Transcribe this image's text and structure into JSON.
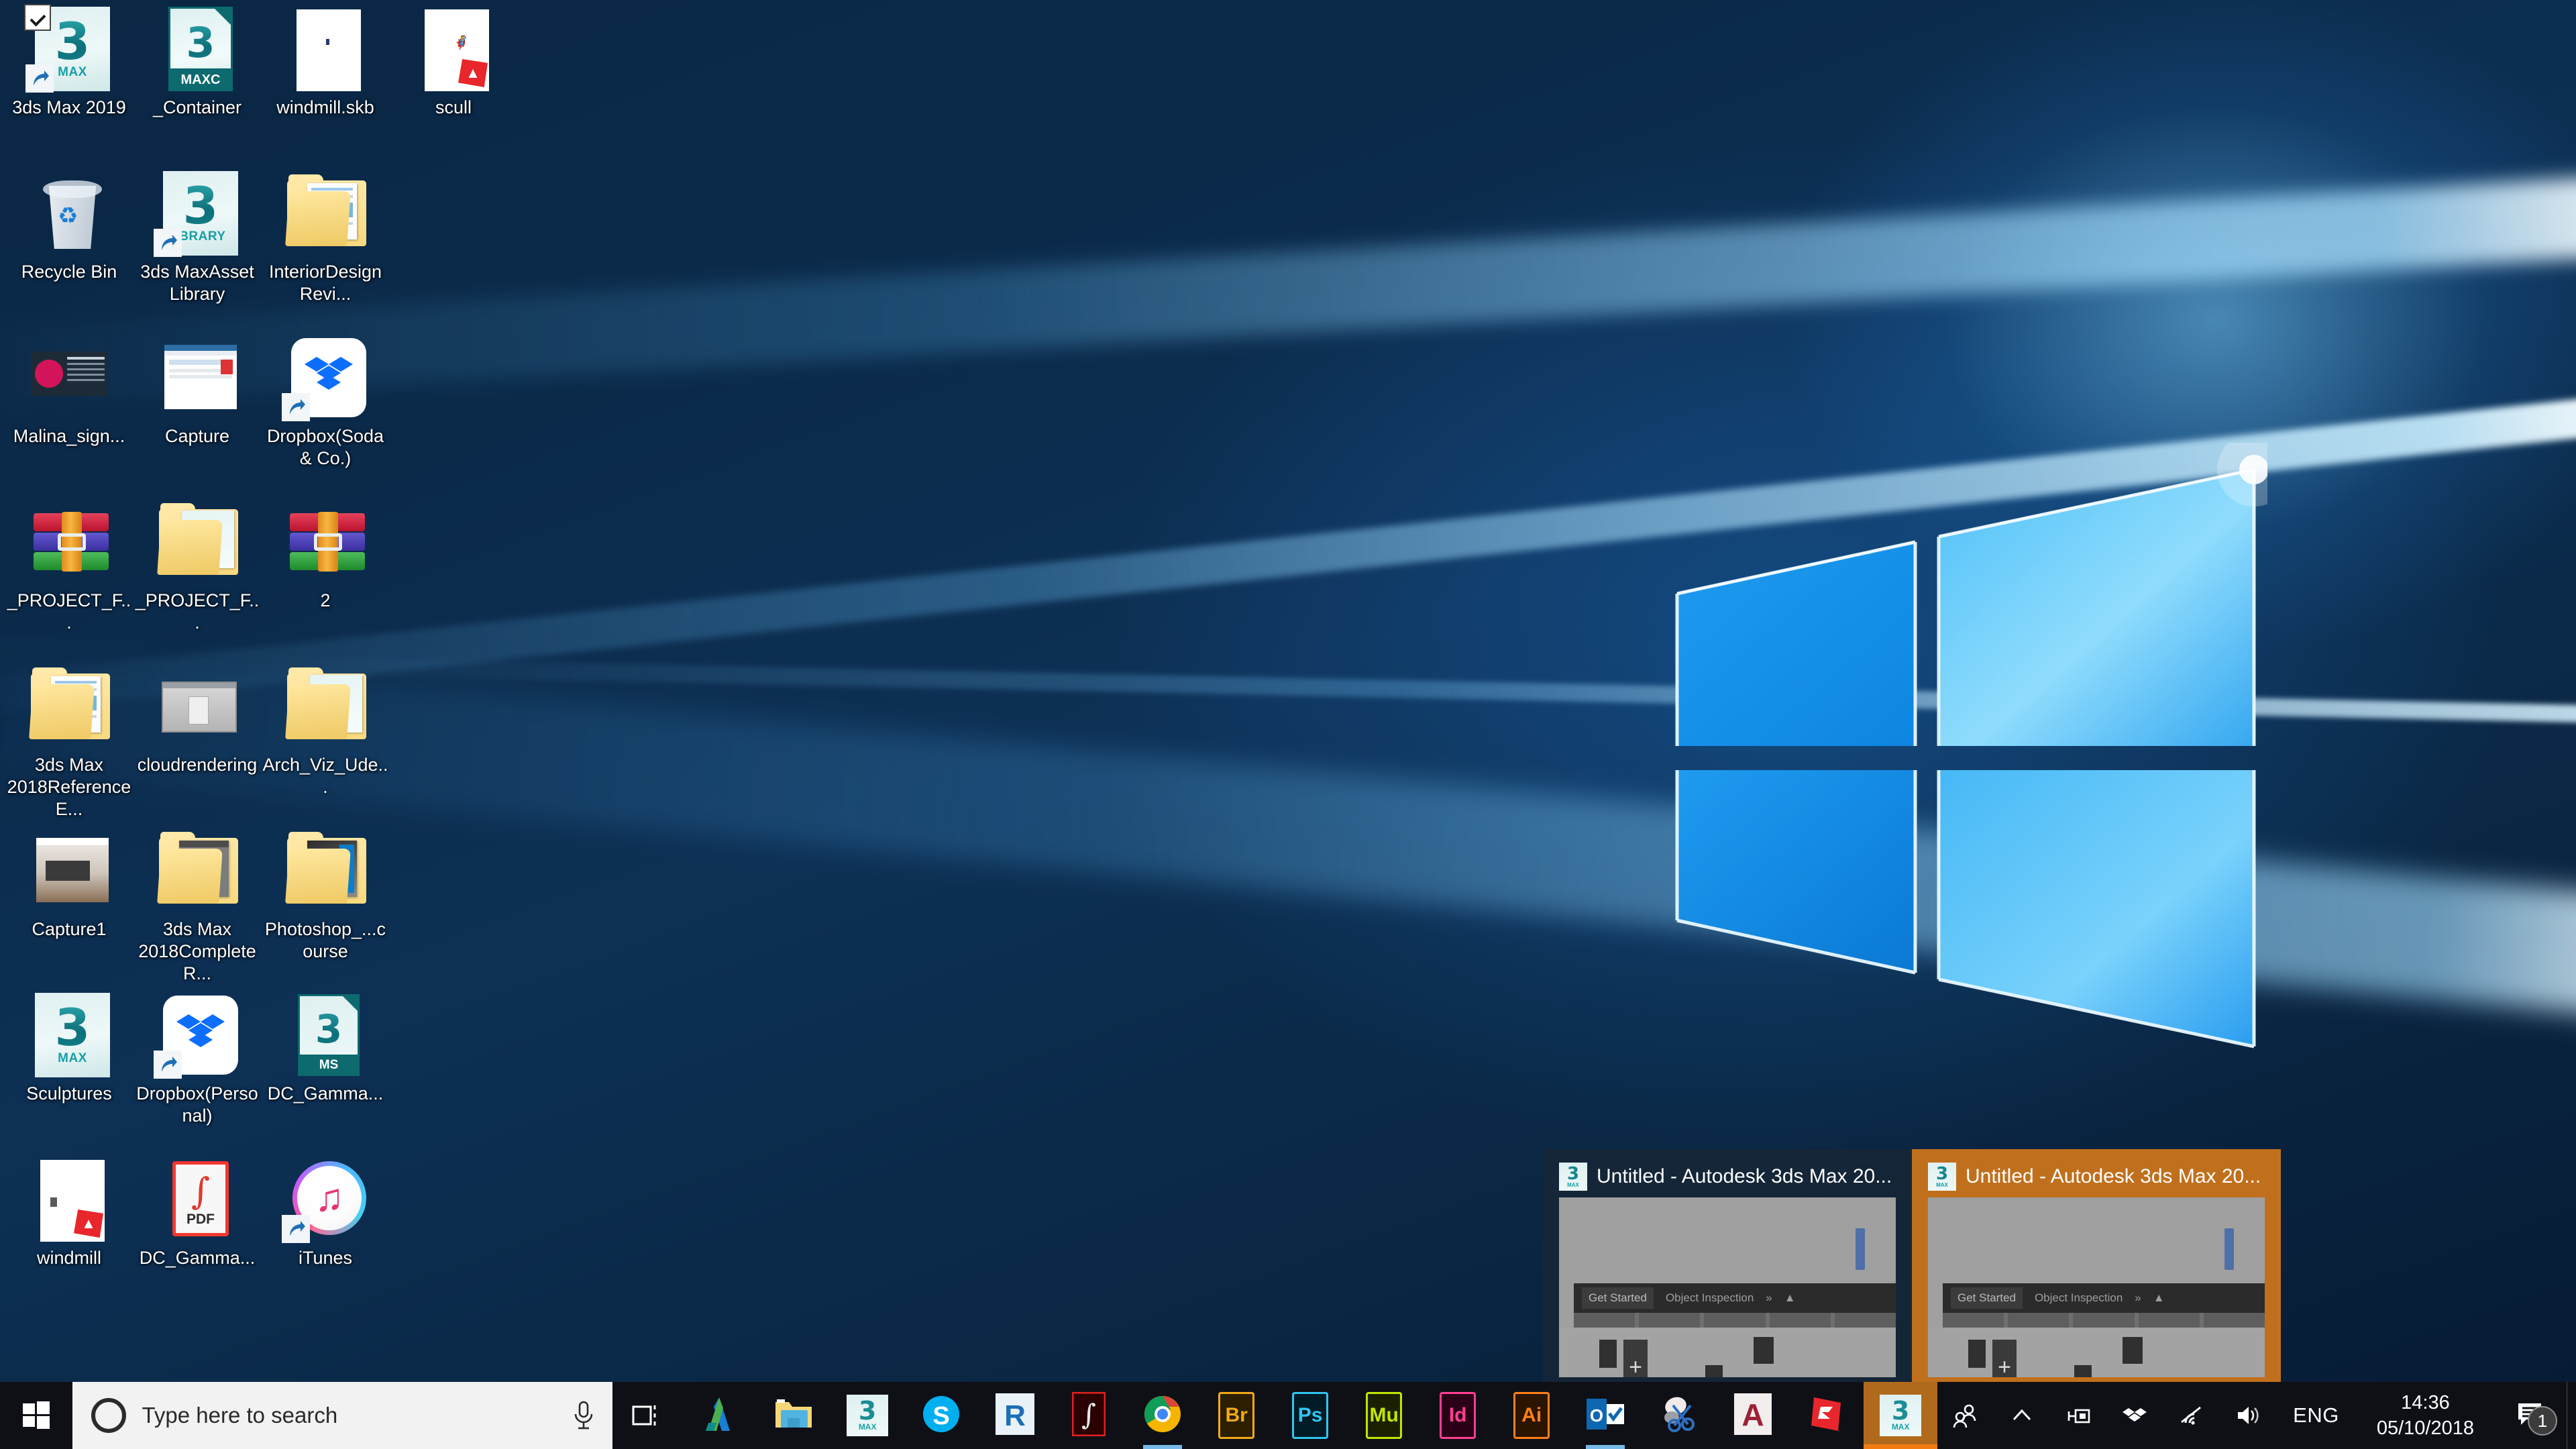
{
  "desktop": {
    "icons": [
      {
        "label": "3ds Max 2019",
        "art": "max-shortcut",
        "selected": true,
        "col": 0,
        "row": 0
      },
      {
        "label": "_Container",
        "art": "maxc-doc",
        "selected": false,
        "col": 1,
        "row": 0
      },
      {
        "label": "windmill.skb",
        "art": "white-doc",
        "selected": false,
        "col": 2,
        "row": 0
      },
      {
        "label": "scull",
        "art": "skp-doc",
        "selected": false,
        "col": 3,
        "row": 0
      },
      {
        "label": "Recycle Bin",
        "art": "recycle-bin",
        "selected": false,
        "col": 0,
        "row": 1
      },
      {
        "label": "3ds Max\nAsset Library",
        "art": "max-library",
        "selected": false,
        "col": 1,
        "row": 1
      },
      {
        "label": "Interior\nDesign Revi...",
        "art": "folder-docs",
        "selected": false,
        "col": 2,
        "row": 1
      },
      {
        "label": "Malina_sign...",
        "art": "signature-card",
        "selected": false,
        "col": 0,
        "row": 2
      },
      {
        "label": "Capture",
        "art": "screenshot",
        "selected": false,
        "col": 1,
        "row": 2
      },
      {
        "label": "Dropbox\n(Soda & Co.)",
        "art": "dropbox",
        "selected": false,
        "col": 2,
        "row": 2
      },
      {
        "label": "_PROJECT_F...",
        "art": "rar-archive",
        "selected": false,
        "col": 0,
        "row": 3
      },
      {
        "label": "_PROJECT_F...",
        "art": "max-folder",
        "selected": false,
        "col": 1,
        "row": 3
      },
      {
        "label": "2",
        "art": "rar-archive",
        "selected": false,
        "col": 2,
        "row": 3
      },
      {
        "label": "3ds Max 2018\nReference E...",
        "art": "folder-docs",
        "selected": false,
        "col": 0,
        "row": 4
      },
      {
        "label": "cloud\nrendering",
        "art": "window-app",
        "selected": false,
        "col": 1,
        "row": 4
      },
      {
        "label": "Arch_Viz\n_Ude...",
        "art": "max-folder",
        "selected": false,
        "col": 2,
        "row": 4
      },
      {
        "label": "Capture1",
        "art": "interior-photo",
        "selected": false,
        "col": 0,
        "row": 5
      },
      {
        "label": "3ds Max 2018\nComplete R...",
        "art": "folder-3dmax",
        "selected": false,
        "col": 1,
        "row": 5
      },
      {
        "label": "Photoshop_...\ncourse",
        "art": "folder-photo",
        "selected": false,
        "col": 2,
        "row": 5
      },
      {
        "label": "Sculptures",
        "art": "max-tile",
        "selected": false,
        "col": 0,
        "row": 6
      },
      {
        "label": "Dropbox\n(Personal)",
        "art": "dropbox-shortcut",
        "selected": false,
        "col": 1,
        "row": 6
      },
      {
        "label": "DC_Gamma...",
        "art": "ms-doc",
        "selected": false,
        "col": 2,
        "row": 6
      },
      {
        "label": "windmill",
        "art": "skp-doc-2",
        "selected": false,
        "col": 0,
        "row": 7
      },
      {
        "label": "DC_Gamma...",
        "art": "pdf-doc",
        "selected": false,
        "col": 1,
        "row": 7
      },
      {
        "label": "iTunes",
        "art": "itunes",
        "selected": false,
        "col": 2,
        "row": 7
      }
    ]
  },
  "thumbnail_preview": {
    "items": [
      {
        "title": "Untitled - Autodesk 3ds Max 20...",
        "icon": "3dsmax-icon",
        "active": false,
        "ribbon_tabs": [
          "Get Started",
          "Object Inspection"
        ]
      },
      {
        "title": "Untitled - Autodesk 3ds Max 20...",
        "icon": "3dsmax-icon",
        "active": true,
        "ribbon_tabs": [
          "Get Started",
          "Object Inspection"
        ]
      }
    ]
  },
  "taskbar": {
    "start_label": "Start",
    "search": {
      "placeholder": "Type here to search",
      "cortana_icon": "cortana-ring-icon",
      "mic_icon": "microphone-icon"
    },
    "task_view_label": "Task View",
    "apps": [
      {
        "name": "Autodesk",
        "icon": "autodesk-icon",
        "label": "A",
        "running": false
      },
      {
        "name": "File Explorer",
        "icon": "file-explorer-icon",
        "label": "",
        "running": false
      },
      {
        "name": "Autodesk 3ds Max",
        "icon": "3dsmax-icon",
        "label": "3",
        "running": false
      },
      {
        "name": "Skype",
        "icon": "skype-icon",
        "label": "S",
        "running": false
      },
      {
        "name": "Autodesk Revit",
        "icon": "revit-icon",
        "label": "R",
        "running": false
      },
      {
        "name": "Adobe Acrobat Reader",
        "icon": "acrobat-icon",
        "label": "",
        "running": false
      },
      {
        "name": "Google Chrome",
        "icon": "chrome-icon",
        "label": "",
        "running": true
      },
      {
        "name": "Adobe Bridge",
        "icon": "bridge-icon",
        "label": "Br",
        "running": false
      },
      {
        "name": "Adobe Photoshop",
        "icon": "photoshop-icon",
        "label": "Ps",
        "running": false
      },
      {
        "name": "Adobe Muse",
        "icon": "muse-icon",
        "label": "Mu",
        "running": false
      },
      {
        "name": "Adobe InDesign",
        "icon": "indesign-icon",
        "label": "Id",
        "running": false
      },
      {
        "name": "Adobe Illustrator",
        "icon": "illustrator-icon",
        "label": "Ai",
        "running": false
      },
      {
        "name": "Microsoft Outlook",
        "icon": "outlook-icon",
        "label": "O",
        "running": true
      },
      {
        "name": "Snipping Tool",
        "icon": "snipping-tool-icon",
        "label": "",
        "running": false
      },
      {
        "name": "Autodesk AutoCAD",
        "icon": "autocad-icon",
        "label": "A",
        "running": false
      },
      {
        "name": "SketchUp",
        "icon": "sketchup-icon",
        "label": "",
        "running": false
      },
      {
        "name": "Autodesk 3ds Max",
        "icon": "3dsmax-icon",
        "label": "3",
        "running": true,
        "active_window": true
      }
    ],
    "tray": [
      {
        "name": "People",
        "icon": "people-icon"
      },
      {
        "name": "Show hidden icons",
        "icon": "chevron-up-icon"
      },
      {
        "name": "Safely Remove Hardware",
        "icon": "usb-eject-icon"
      },
      {
        "name": "Dropbox",
        "icon": "dropbox-tray-icon"
      },
      {
        "name": "Network",
        "icon": "wifi-icon"
      },
      {
        "name": "Volume",
        "icon": "speaker-icon"
      }
    ],
    "language": "ENG",
    "clock": {
      "time": "14:36",
      "date": "05/10/2018"
    },
    "action_center": {
      "icon": "notification-icon",
      "badge_count": "1"
    }
  },
  "colors": {
    "taskbar_bg": "#0e1016",
    "search_bg": "#f2f2f2",
    "active_window_highlight": "#b06a1c",
    "active_underline": "#f07c12",
    "running_underline": "#76b9e8",
    "wallpaper_blue": "#0d3055",
    "desktop_text": "#ffffff"
  }
}
